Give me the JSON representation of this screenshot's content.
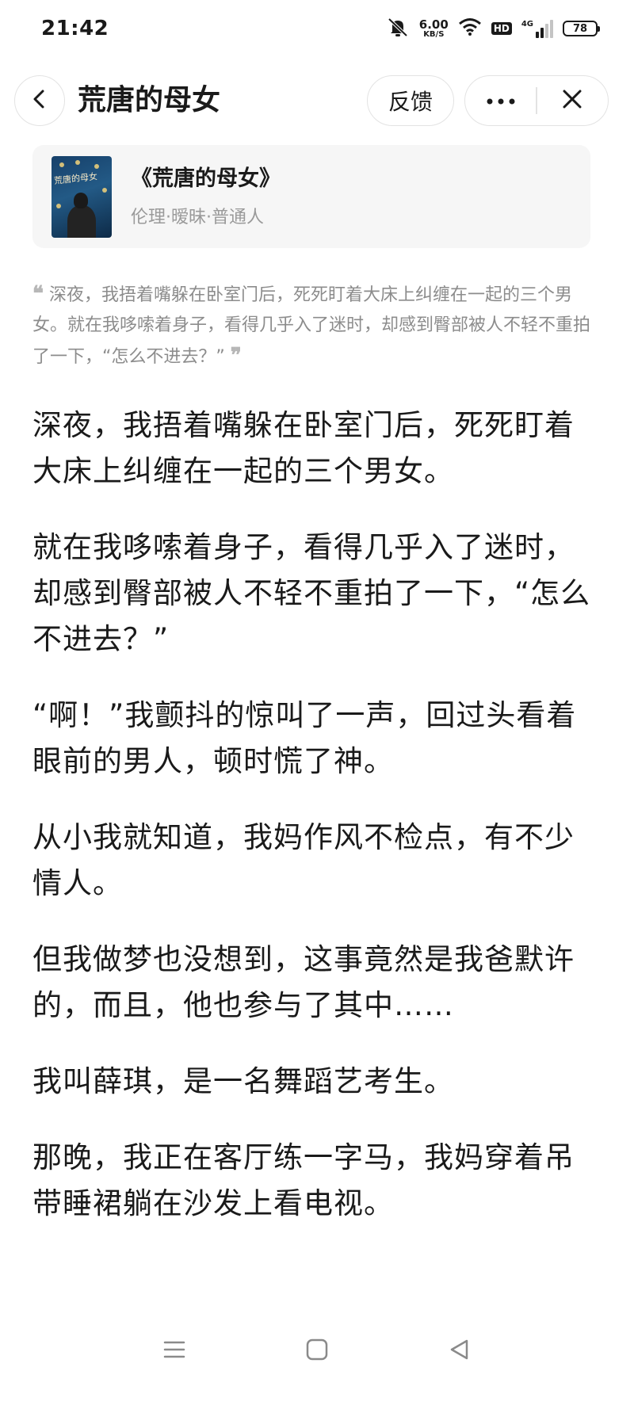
{
  "status_bar": {
    "time": "21:42",
    "net_speed_value": "6.00",
    "net_speed_unit": "KB/S",
    "hd_label": "HD",
    "network_label": "4G",
    "battery_level": "78"
  },
  "header": {
    "title": "荒唐的母女",
    "feedback_label": "反馈"
  },
  "book_card": {
    "title": "《荒唐的母女》",
    "tags": "伦理·暧昧·普通人",
    "cover_title": "荒唐的母女"
  },
  "summary": {
    "text": "深夜，我捂着嘴躲在卧室门后，死死盯着大床上纠缠在一起的三个男女。就在我哆嗦着身子，看得几乎入了迷时，却感到臀部被人不轻不重拍了一下，“怎么不进去？”"
  },
  "paragraphs": [
    "深夜，我捂着嘴躲在卧室门后，死死盯着大床上纠缠在一起的三个男女。",
    "就在我哆嗦着身子，看得几乎入了迷时，却感到臀部被人不轻不重拍了一下，“怎么不进去？”",
    "“啊！”我颤抖的惊叫了一声，回过头看着眼前的男人，顿时慌了神。",
    "从小我就知道，我妈作风不检点，有不少情人。",
    "但我做梦也没想到，这事竟然是我爸默许的，而且，他也参与了其中……",
    "我叫薛琪，是一名舞蹈艺考生。",
    "那晚，我正在客厅练一字马，我妈穿着吊带睡裙躺在沙发上看电视。"
  ],
  "icons": {
    "status": [
      "mute-bell-icon",
      "wifi-icon",
      "signal-icon",
      "battery-icon"
    ],
    "header": [
      "back-arrow-icon",
      "more-dots-icon",
      "close-icon"
    ],
    "nav": [
      "menu-icon",
      "home-square-icon",
      "back-triangle-icon"
    ]
  }
}
